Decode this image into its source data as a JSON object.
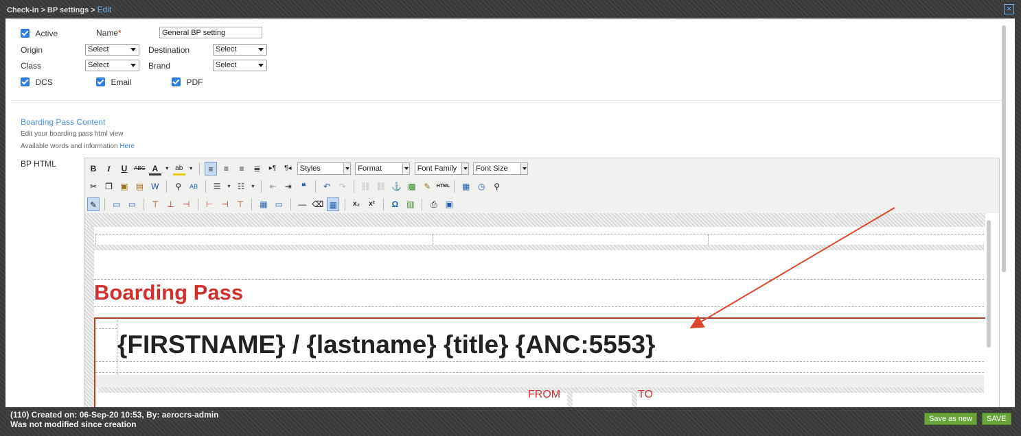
{
  "breadcrumb": {
    "items": [
      "Check-in",
      "BP settings"
    ],
    "separator": ">",
    "current": "Edit"
  },
  "window": {
    "close_icon": "×"
  },
  "form": {
    "active_label": "Active",
    "name_label": "Name",
    "name_required": "*",
    "name_value": "General BP setting",
    "origin_label": "Origin",
    "origin_value": "Select",
    "destination_label": "Destination",
    "destination_value": "Select",
    "class_label": "Class",
    "class_value": "Select",
    "brand_label": "Brand",
    "brand_value": "Select",
    "dcs_label": "DCS",
    "email_label": "Email",
    "pdf_label": "PDF"
  },
  "section": {
    "title": "Boarding Pass Content",
    "subtitle": "Edit your boarding pass html view",
    "info_text": "Available words and information",
    "info_link": "Here",
    "bp_html_label": "BP HTML"
  },
  "editor": {
    "toolbar1": [
      "B",
      "I",
      "U",
      "ABC",
      "A",
      "ab"
    ],
    "styles_label": "Styles",
    "format_label": "Format",
    "font_family_label": "Font Family",
    "font_size_label": "Font Size",
    "heading": "Boarding Pass",
    "placeholder_line": "{FIRSTNAME} / {lastname} {title} {ANC:5553}",
    "from_label": "FROM",
    "to_label": "TO"
  },
  "footer": {
    "created": "(110) Created on: 06-Sep-20 10:53, By: aerocrs-admin",
    "modified": "Was not modified since creation",
    "save_as_new": "Save as new",
    "save": "SAVE"
  },
  "colors": {
    "accent_blue": "#2f7ce0",
    "heading_red": "#d0312d",
    "button_green": "#6ba53a",
    "arrow_red": "#e0472f"
  }
}
